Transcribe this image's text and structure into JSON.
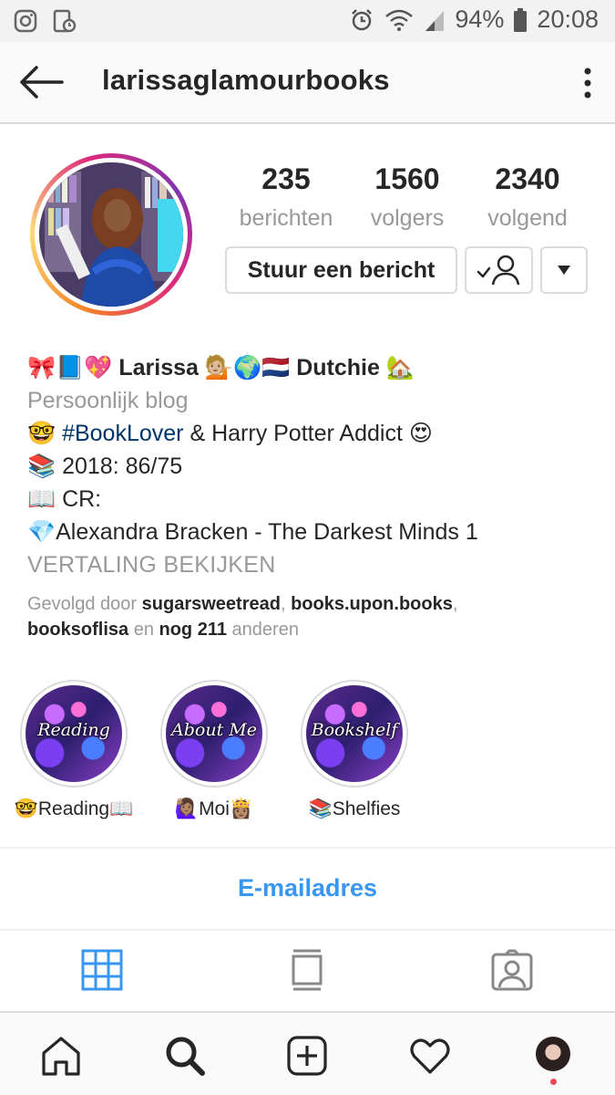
{
  "status_bar": {
    "battery_percent": "94%",
    "time": "20:08"
  },
  "header": {
    "username": "larissaglamourbooks"
  },
  "stats": [
    {
      "value": "235",
      "label": "berichten"
    },
    {
      "value": "1560",
      "label": "volgers"
    },
    {
      "value": "2340",
      "label": "volgend"
    }
  ],
  "actions": {
    "message_label": "Stuur een bericht"
  },
  "bio": {
    "name_line_prefix": "🎀📘💖 ",
    "name": "Larissa",
    "name_line_suffix": " 💁🏼🌍🇳🇱 ",
    "name_extra": "Dutchie",
    "name_line_end": " 🏡",
    "category": "Persoonlijk blog",
    "line1_prefix": "🤓 ",
    "line1_hashtag": "#BookLover",
    "line1_rest": " & Harry Potter Addict 😍",
    "line2": "📚 2018: 86/75",
    "line3": "📖 CR:",
    "line4": "💎Alexandra Bracken - The Darkest Minds 1",
    "translate": "VERTALING BEKIJKEN"
  },
  "followed_by": {
    "prefix": "Gevolgd door ",
    "user1": "sugarsweetread",
    "sep1": ", ",
    "user2": "books.upon.books",
    "sep2": ",",
    "user3": "booksoflisa",
    "and": " en ",
    "others_count": "nog 211",
    "suffix": " anderen"
  },
  "highlights": [
    {
      "cover_text": "Reading",
      "label": "🤓Reading📖"
    },
    {
      "cover_text": "About Me",
      "label": "🙋🏽‍♀️Moi👸🏽"
    },
    {
      "cover_text": "Bookshelf",
      "label": "📚Shelfies"
    }
  ],
  "contact": {
    "email_label": "E-mailadres"
  },
  "colors": {
    "accent": "#3897f0",
    "text": "#262626",
    "muted": "#999999",
    "hashtag": "#003569",
    "notification_dot": "#ed4956"
  }
}
